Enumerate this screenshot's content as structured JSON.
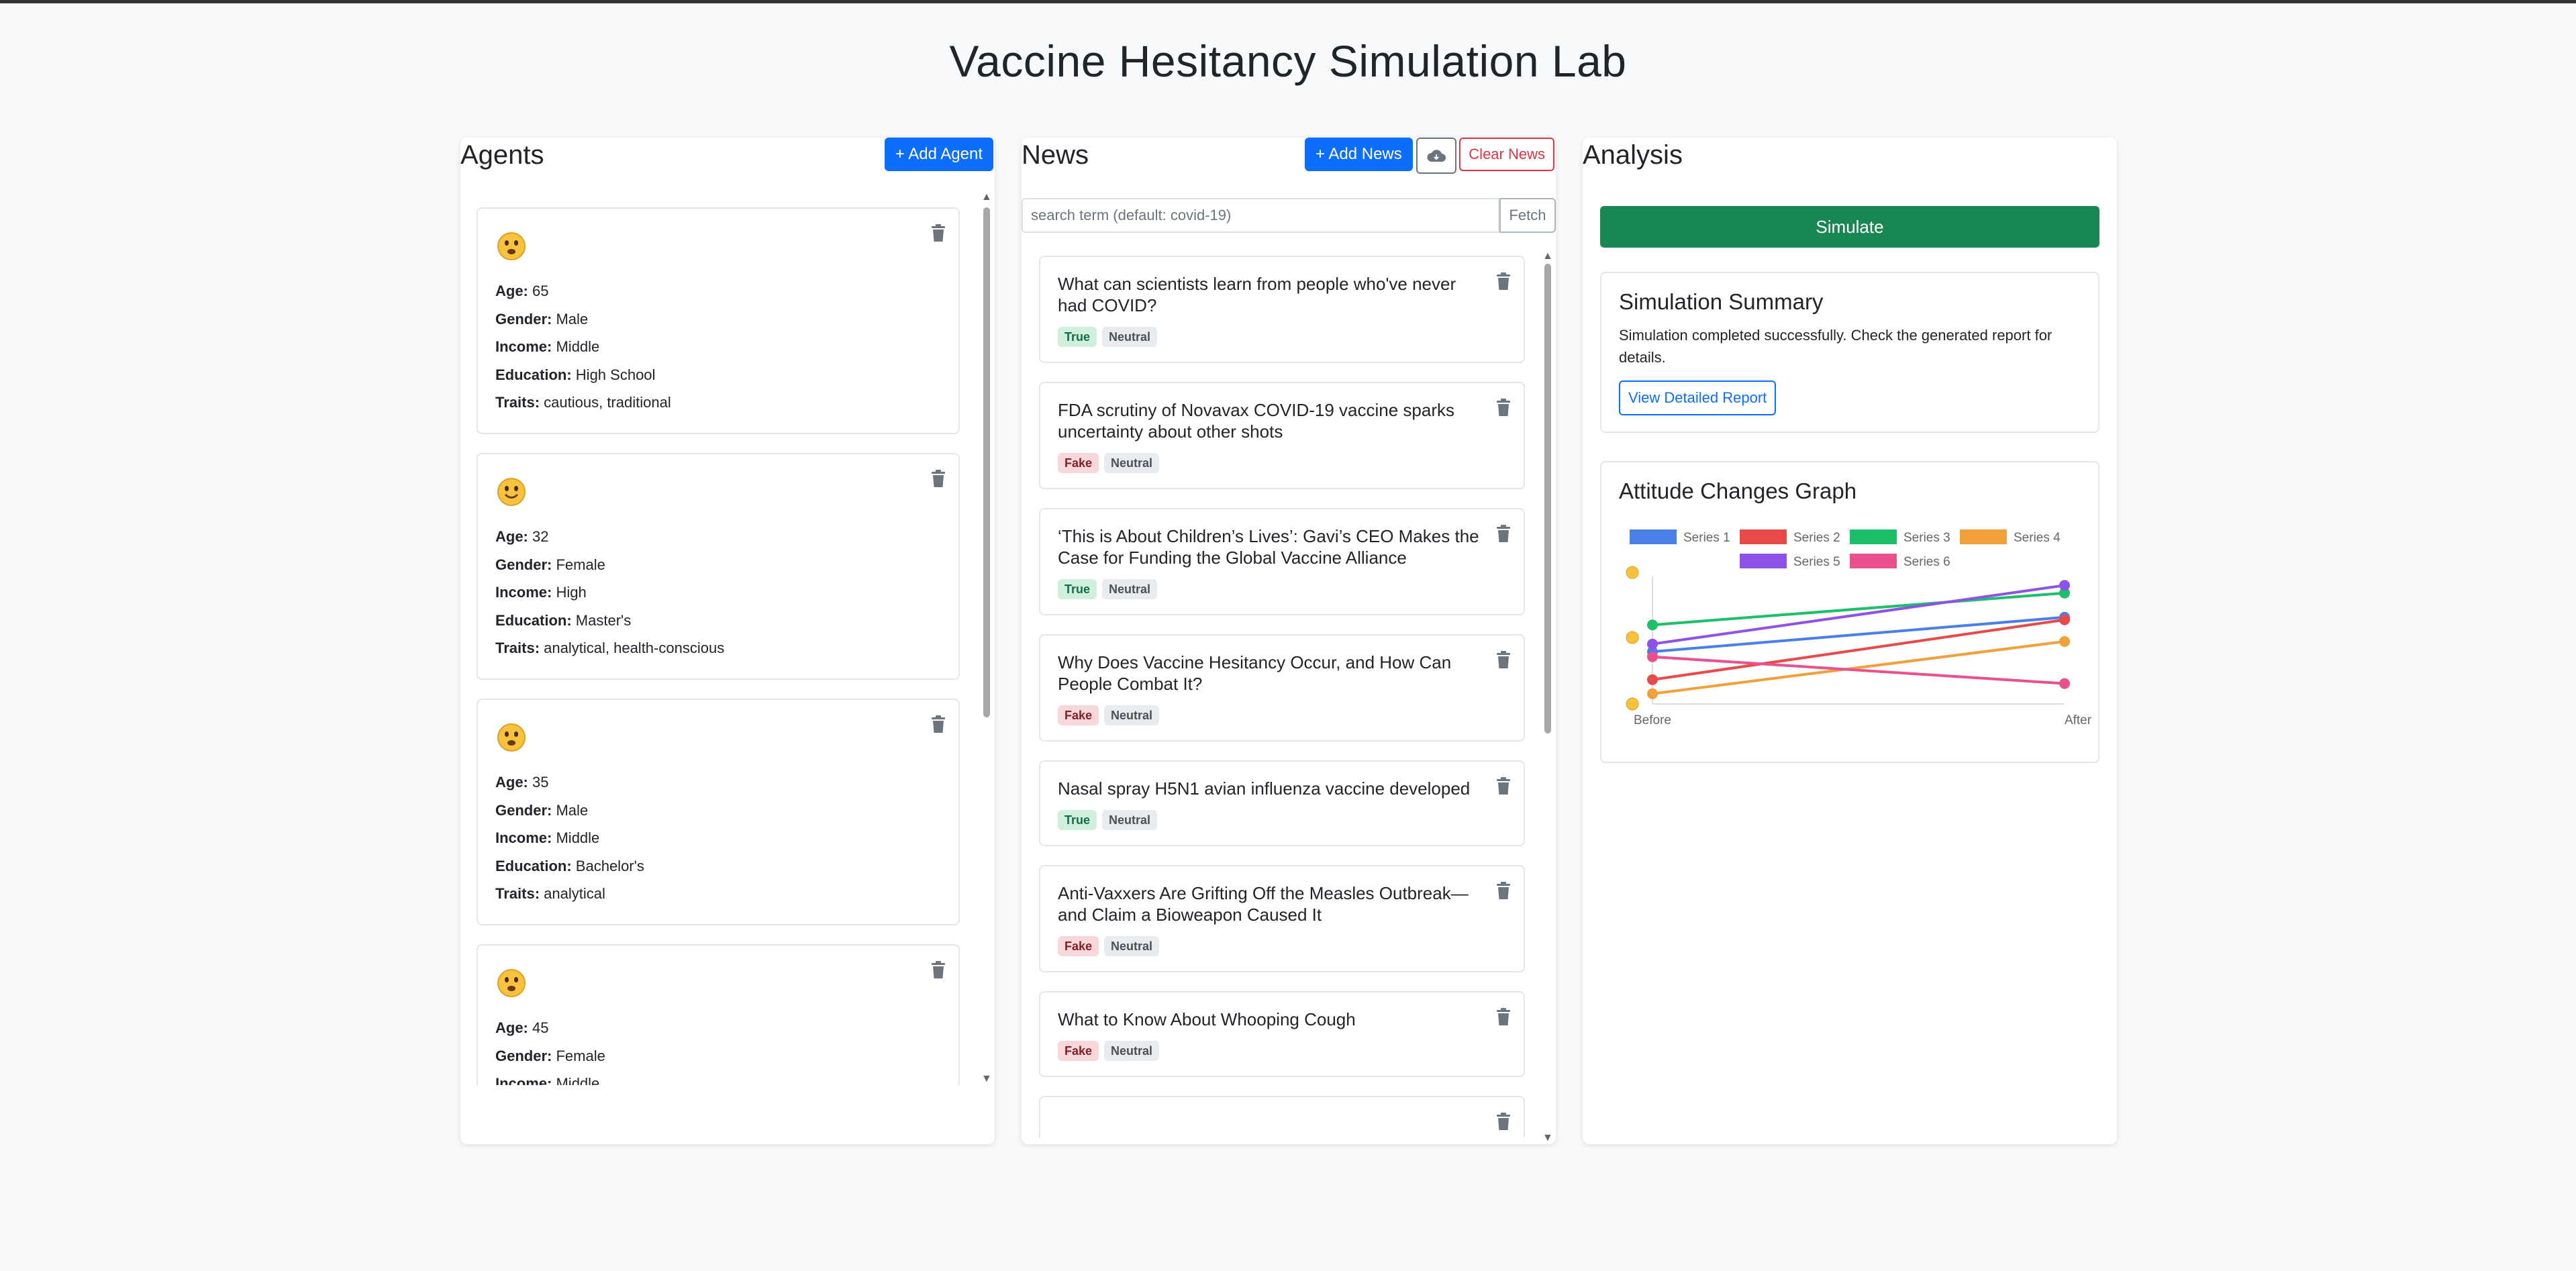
{
  "page": {
    "title": "Vaccine Hesitancy Simulation Lab"
  },
  "agents": {
    "title": "Agents",
    "add_label": "+ Add Agent",
    "labels": {
      "age": "Age:",
      "gender": "Gender:",
      "income": "Income:",
      "education": "Education:",
      "traits": "Traits:"
    },
    "items": [
      {
        "emoji": "face-with-open-mouth-icon",
        "age": "65",
        "gender": "Male",
        "income": "Middle",
        "education": "High School",
        "traits": "cautious, traditional"
      },
      {
        "emoji": "smiling-face-icon",
        "age": "32",
        "gender": "Female",
        "income": "High",
        "education": "Master's",
        "traits": "analytical, health-conscious"
      },
      {
        "emoji": "face-with-open-mouth-icon",
        "age": "35",
        "gender": "Male",
        "income": "Middle",
        "education": "Bachelor's",
        "traits": "analytical"
      },
      {
        "emoji": "face-with-open-mouth-icon",
        "age": "45",
        "gender": "Female",
        "income": "Middle",
        "education": "",
        "traits": ""
      }
    ]
  },
  "news": {
    "title": "News",
    "add_label": "+ Add News",
    "clear_label": "Clear News",
    "search_placeholder": "search term (default: covid-19)",
    "fetch_label": "Fetch",
    "items": [
      {
        "headline": "What can scientists learn from people who've never had COVID?",
        "veracity": "True",
        "stance": "Neutral"
      },
      {
        "headline": "FDA scrutiny of Novavax COVID-19 vaccine sparks uncertainty about other shots",
        "veracity": "Fake",
        "stance": "Neutral"
      },
      {
        "headline": "‘This is About Children’s Lives’: Gavi’s CEO Makes the Case for Funding the Global Vaccine Alliance",
        "veracity": "True",
        "stance": "Neutral"
      },
      {
        "headline": "Why Does Vaccine Hesitancy Occur, and How Can People Combat It?",
        "veracity": "Fake",
        "stance": "Neutral"
      },
      {
        "headline": "Nasal spray H5N1 avian influenza vaccine developed",
        "veracity": "True",
        "stance": "Neutral"
      },
      {
        "headline": "Anti-Vaxxers Are Grifting Off the Measles Outbreak—and Claim a Bioweapon Caused It",
        "veracity": "Fake",
        "stance": "Neutral"
      },
      {
        "headline": "What to Know About Whooping Cough",
        "veracity": "Fake",
        "stance": "Neutral"
      }
    ]
  },
  "analysis": {
    "title": "Analysis",
    "simulate_label": "Simulate",
    "summary_title": "Simulation Summary",
    "summary_text": "Simulation completed successfully. Check the generated report for details.",
    "report_label": "View Detailed Report",
    "graph_title": "Attitude Changes Graph"
  },
  "chart_data": {
    "type": "line",
    "x": [
      "Before",
      "After"
    ],
    "y_axis": "emoji faces",
    "series": [
      {
        "name": "Series 1",
        "color": "#4a7fe8",
        "values": [
          0.41,
          0.68
        ]
      },
      {
        "name": "Series 2",
        "color": "#e84a4a",
        "values": [
          0.19,
          0.66
        ]
      },
      {
        "name": "Series 3",
        "color": "#1cbf6a",
        "values": [
          0.62,
          0.87
        ]
      },
      {
        "name": "Series 4",
        "color": "#f2a03a",
        "values": [
          0.08,
          0.49
        ]
      },
      {
        "name": "Series 5",
        "color": "#8f52e8",
        "values": [
          0.47,
          0.93
        ]
      },
      {
        "name": "Series 6",
        "color": "#e8508e",
        "values": [
          0.37,
          0.16
        ]
      }
    ],
    "legend": "top",
    "grid": false
  }
}
